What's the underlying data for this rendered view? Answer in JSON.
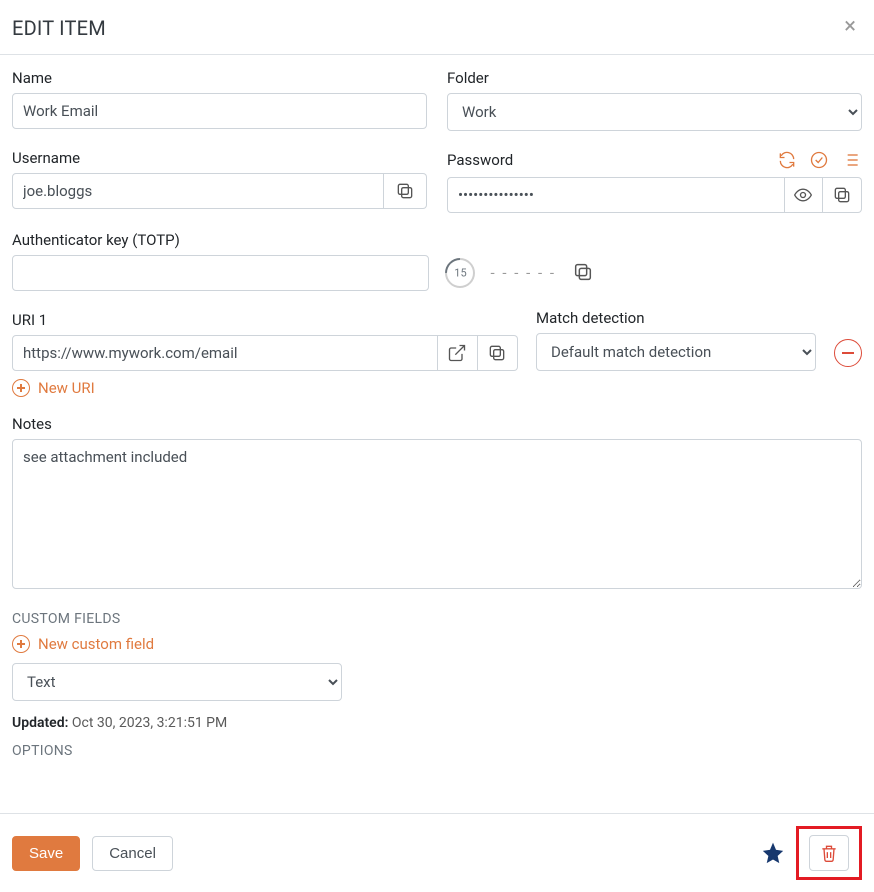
{
  "modal": {
    "title": "EDIT ITEM"
  },
  "labels": {
    "name": "Name",
    "folder": "Folder",
    "username": "Username",
    "password": "Password",
    "authKey": "Authenticator key (TOTP)",
    "uri1": "URI 1",
    "matchDetection": "Match detection",
    "newUri": "New URI",
    "notes": "Notes",
    "customFieldsHeading": "CUSTOM FIELDS",
    "newCustomField": "New custom field",
    "optionsHeading": "OPTIONS",
    "save": "Save",
    "cancel": "Cancel"
  },
  "values": {
    "name": "Work Email",
    "folder": "Work",
    "username": "joe.bloggs",
    "passwordMask": "•••••••••••••••",
    "authKey": "",
    "totpTimer": "15",
    "totpCodes": "- - -    - - -",
    "uri1": "https://www.mywork.com/email",
    "matchDetection": "Default match detection",
    "notes": "see attachment included",
    "customFieldType": "Text"
  },
  "updated": {
    "label": "Updated:",
    "value": "Oct 30, 2023, 3:21:51 PM"
  },
  "colors": {
    "accent": "#e07a3f",
    "danger": "#dd4b39",
    "trashHighlight": "#e31b23",
    "star": "#17386e"
  }
}
